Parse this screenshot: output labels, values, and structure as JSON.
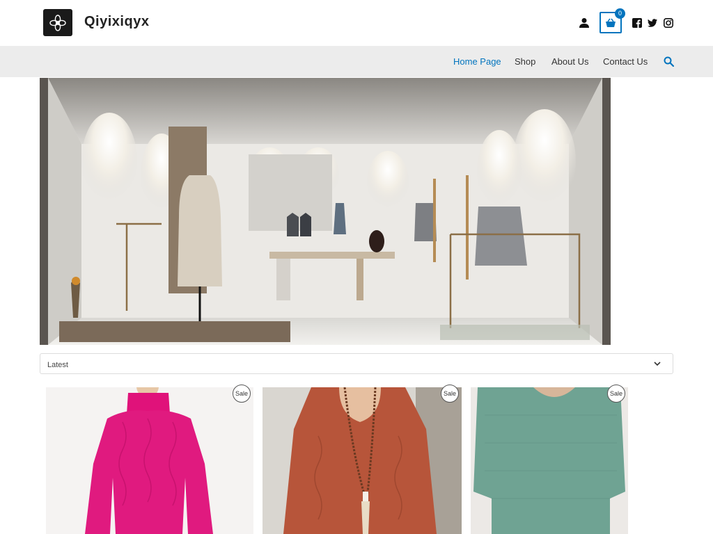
{
  "header": {
    "site_title": "Qiyixiqyx",
    "cart_count": "0"
  },
  "nav": {
    "items": [
      {
        "label": "Home Page",
        "active": true
      },
      {
        "label": "Shop",
        "active": false
      },
      {
        "label": "About Us",
        "active": false
      },
      {
        "label": "Contact Us",
        "active": false
      }
    ]
  },
  "sort": {
    "selected": "Latest"
  },
  "products": [
    {
      "badge": "Sale",
      "image": "pink-cable-knit-sweater"
    },
    {
      "badge": "Sale",
      "image": "rust-hooded-sweater-with-necklace"
    },
    {
      "badge": "Sale",
      "image": "teal-knit-sweater"
    }
  ],
  "colors": {
    "accent": "#0274be",
    "nav_bg": "#ececec"
  }
}
